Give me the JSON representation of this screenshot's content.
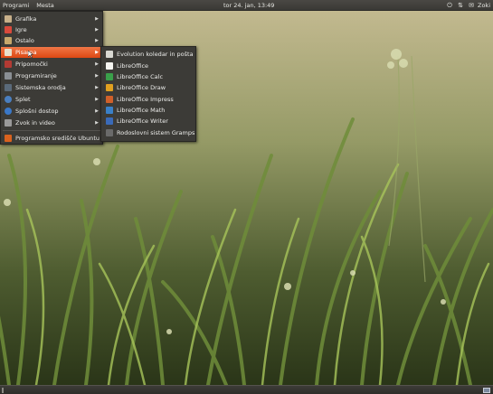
{
  "top_panel": {
    "menus": [
      "Programi",
      "Mesta"
    ],
    "clock": "tor 24. jan, 13:49",
    "user": "Zoki",
    "tray_icons": [
      "power-icon",
      "network-icon",
      "chat-icon"
    ]
  },
  "applications_menu": {
    "items": [
      {
        "label": "Grafika",
        "icon": "graphics-icon",
        "color": "#c8b08a"
      },
      {
        "label": "Igre",
        "icon": "games-icon",
        "color": "#d94a3c"
      },
      {
        "label": "Ostalo",
        "icon": "other-icon",
        "color": "#c7a86c"
      },
      {
        "label": "Pisarna",
        "icon": "office-icon",
        "color": "#e8e0cc",
        "active": true
      },
      {
        "label": "Pripomočki",
        "icon": "accessories-icon",
        "color": "#b33a33"
      },
      {
        "label": "Programiranje",
        "icon": "programming-icon",
        "color": "#8a8f94"
      },
      {
        "label": "Sistemska orodja",
        "icon": "system-tools-icon",
        "color": "#5a6a7a"
      },
      {
        "label": "Splet",
        "icon": "internet-icon",
        "color": "#4a7fc0"
      },
      {
        "label": "Splošni dostop",
        "icon": "accessibility-icon",
        "color": "#3a78c8"
      },
      {
        "label": "Zvok in video",
        "icon": "sound-video-icon",
        "color": "#9a9a9a"
      }
    ],
    "footer_item": {
      "label": "Programsko središče Ubuntu",
      "icon": "software-center-icon",
      "color": "#d9621e"
    }
  },
  "office_submenu": {
    "items": [
      {
        "label": "Evolution koledar in pošta",
        "icon": "evolution-icon",
        "color": "#d8d8d2"
      },
      {
        "label": "LibreOffice",
        "icon": "libreoffice-icon",
        "color": "#f4f4f0"
      },
      {
        "label": "LibreOffice Calc",
        "icon": "libreoffice-calc-icon",
        "color": "#3aa04a"
      },
      {
        "label": "LibreOffice Draw",
        "icon": "libreoffice-draw-icon",
        "color": "#e0a020"
      },
      {
        "label": "LibreOffice Impress",
        "icon": "libreoffice-impress-icon",
        "color": "#d0602a"
      },
      {
        "label": "LibreOffice Math",
        "icon": "libreoffice-math-icon",
        "color": "#3a80c8"
      },
      {
        "label": "LibreOffice Writer",
        "icon": "libreoffice-writer-icon",
        "color": "#3a6ab8"
      },
      {
        "label": "Rodoslovni sistem Gramps",
        "icon": "gramps-icon",
        "color": "#6a6a6a"
      }
    ]
  }
}
